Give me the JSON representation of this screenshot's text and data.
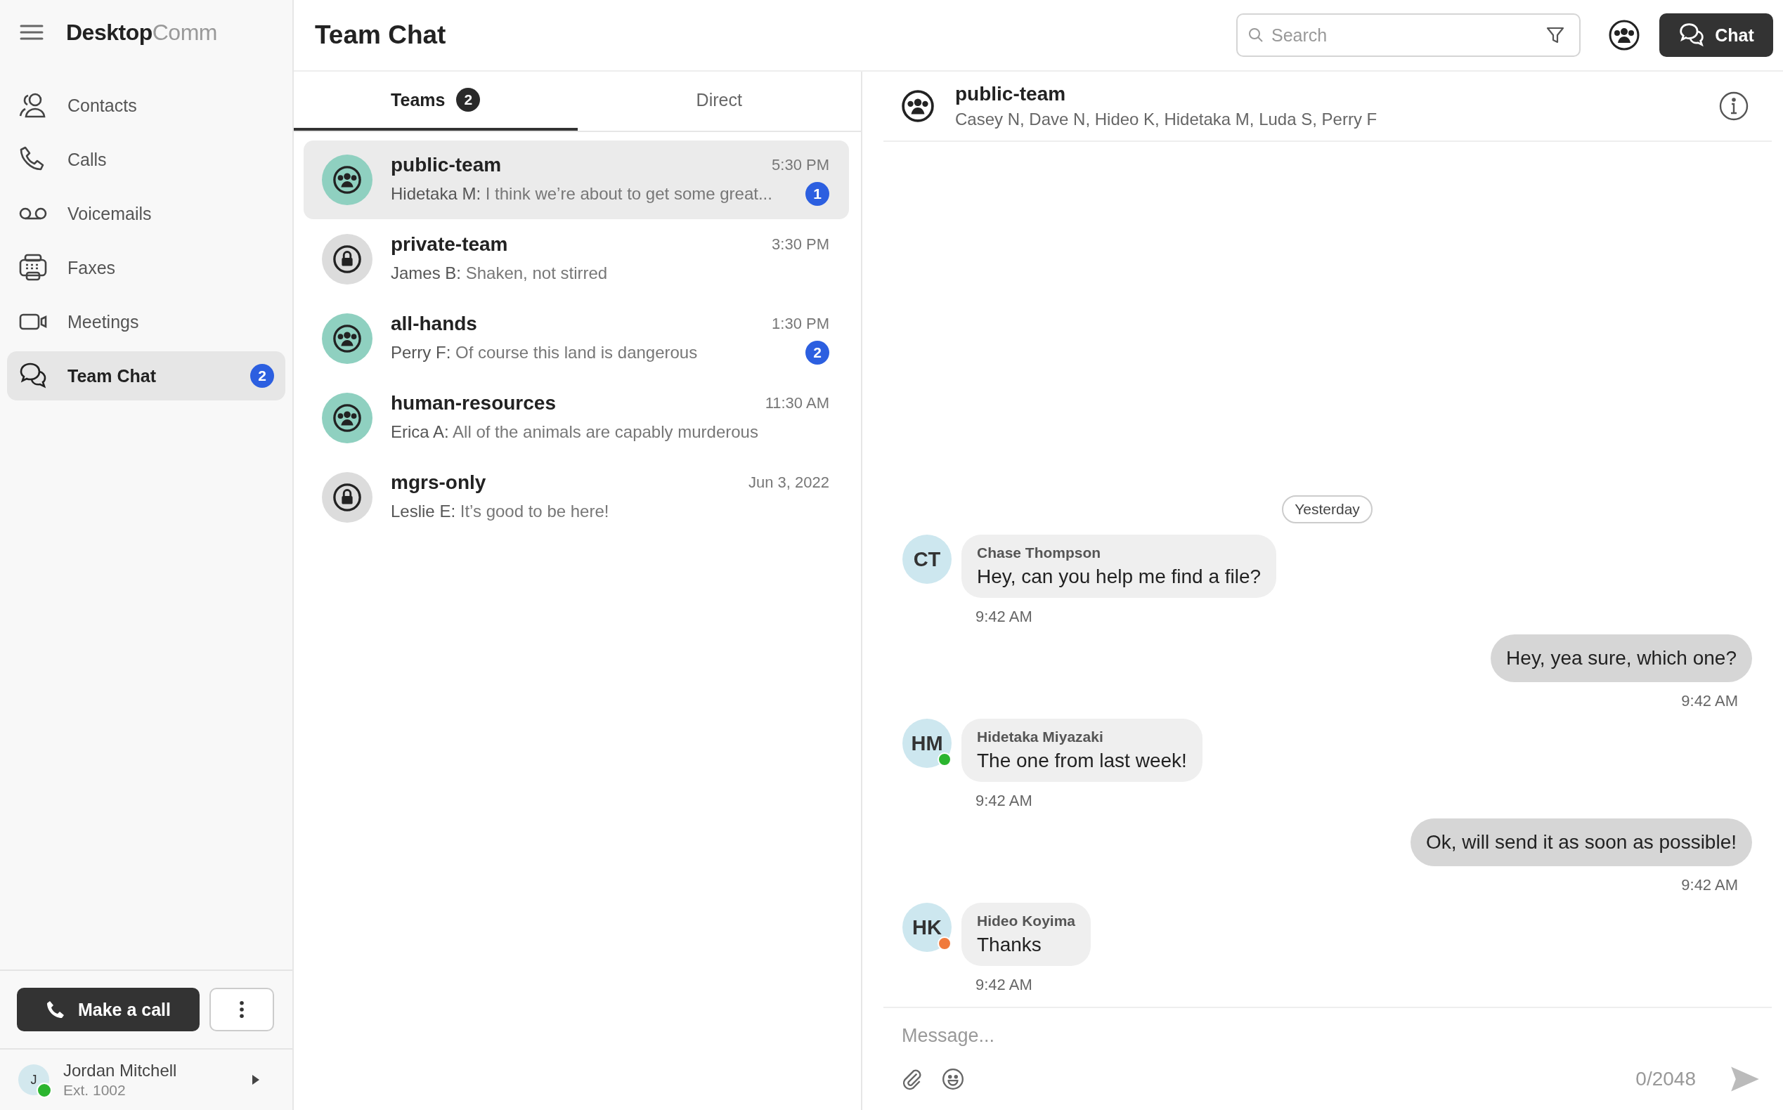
{
  "sidebar": {
    "logo": {
      "bold": "Desktop",
      "light": "Comm"
    },
    "nav": [
      {
        "kind": "contacts",
        "label": "Contacts",
        "selected": false
      },
      {
        "kind": "calls",
        "label": "Calls",
        "selected": false
      },
      {
        "kind": "voicemails",
        "label": "Voicemails",
        "selected": false
      },
      {
        "kind": "faxes",
        "label": "Faxes",
        "selected": false
      },
      {
        "kind": "meetings",
        "label": "Meetings",
        "selected": false
      },
      {
        "kind": "chat",
        "label": "Team Chat",
        "selected": true,
        "badge": "2"
      }
    ],
    "call_button": "Make a call",
    "user": {
      "initial": "J",
      "name": "Jordan Mitchell",
      "ext": "Ext. 1002",
      "color": "#2bb52f"
    }
  },
  "header": {
    "title": "Team Chat",
    "search": {
      "placeholder": "Search"
    },
    "chat_button": "Chat"
  },
  "tabs": [
    {
      "label": "Teams",
      "count": "2",
      "selected": true
    },
    {
      "label": "Direct",
      "selected": false
    }
  ],
  "teams": [
    {
      "kind": "public",
      "name": "public-team",
      "time": "5:30 PM",
      "sender": "Hidetaka M:",
      "preview": "I think we’re about to get some great...",
      "unread": "1",
      "selected": true
    },
    {
      "kind": "private",
      "name": "private-team",
      "time": "3:30 PM",
      "sender": "James B:",
      "preview": "Shaken, not stirred",
      "selected": false
    },
    {
      "kind": "public",
      "name": "all-hands",
      "time": "1:30 PM",
      "sender": "Perry F:",
      "preview": "Of course this land is dangerous",
      "unread": "2",
      "selected": false
    },
    {
      "kind": "public",
      "name": "human-resources",
      "time": "11:30 AM",
      "sender": "Erica A:",
      "preview": "All of the animals are capably murderous",
      "selected": false
    },
    {
      "kind": "private",
      "name": "mgrs-only",
      "time": "Jun 3, 2022",
      "sender": "Leslie E:",
      "preview": "It’s good to be here!",
      "selected": false
    }
  ],
  "conversation": {
    "title": "public-team",
    "members": "Casey N, Dave N, Hideo K, Hidetaka M, Luda S, Perry F",
    "date_divider": "Yesterday",
    "messages": [
      {
        "kind": "incoming",
        "initials": "CT",
        "sender": "Chase Thompson",
        "text": "Hey, can you help me find a file?",
        "time": "9:42 AM"
      },
      {
        "kind": "outgoing",
        "text": "Hey, yea sure, which one?",
        "time": "9:42 AM"
      },
      {
        "kind": "incoming",
        "initials": "HM",
        "sender": "Hidetaka Miyazaki",
        "text": "The one from last week!",
        "time": "9:42 AM",
        "color": "#2bb52f"
      },
      {
        "kind": "outgoing",
        "text": "Ok, will send it as soon as possible!",
        "time": "9:42 AM"
      },
      {
        "kind": "incoming",
        "initials": "HK",
        "sender": "Hideo Koyima",
        "text": "Thanks",
        "time": "9:42 AM",
        "color": "#f07a3c"
      }
    ],
    "composer": {
      "placeholder": "Message...",
      "counter": "0/2048"
    }
  }
}
